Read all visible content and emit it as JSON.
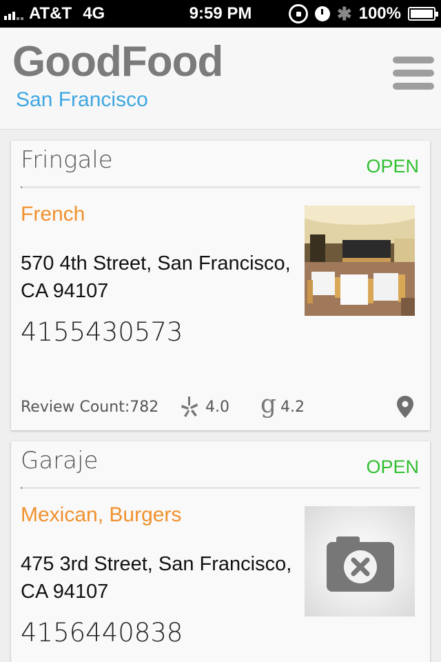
{
  "status_bar": {
    "carrier": "AT&T",
    "network": "4G",
    "time": "9:59 PM",
    "battery": "100%"
  },
  "header": {
    "app_title": "GoodFood",
    "city": "San Francisco"
  },
  "restaurants": [
    {
      "name": "Fringale",
      "status": "OPEN",
      "cuisine": "French",
      "address": "570 4th Street, San Francisco, CA 94107",
      "phone": "4155430573",
      "review_count": "Review Count:782",
      "yelp_rating": "4.0",
      "google_rating": "4.2",
      "photo": "restaurant-interior"
    },
    {
      "name": "Garaje",
      "status": "OPEN",
      "cuisine": "Mexican, Burgers",
      "address": "475 3rd Street, San Francisco, CA 94107",
      "phone": "4156440838",
      "photo": "no-photo-camera-icon"
    }
  ],
  "colors": {
    "status_open": "#2fbf2f",
    "cuisine": "#f0912e",
    "city": "#3ea7e1",
    "title": "#7b7b7b"
  }
}
